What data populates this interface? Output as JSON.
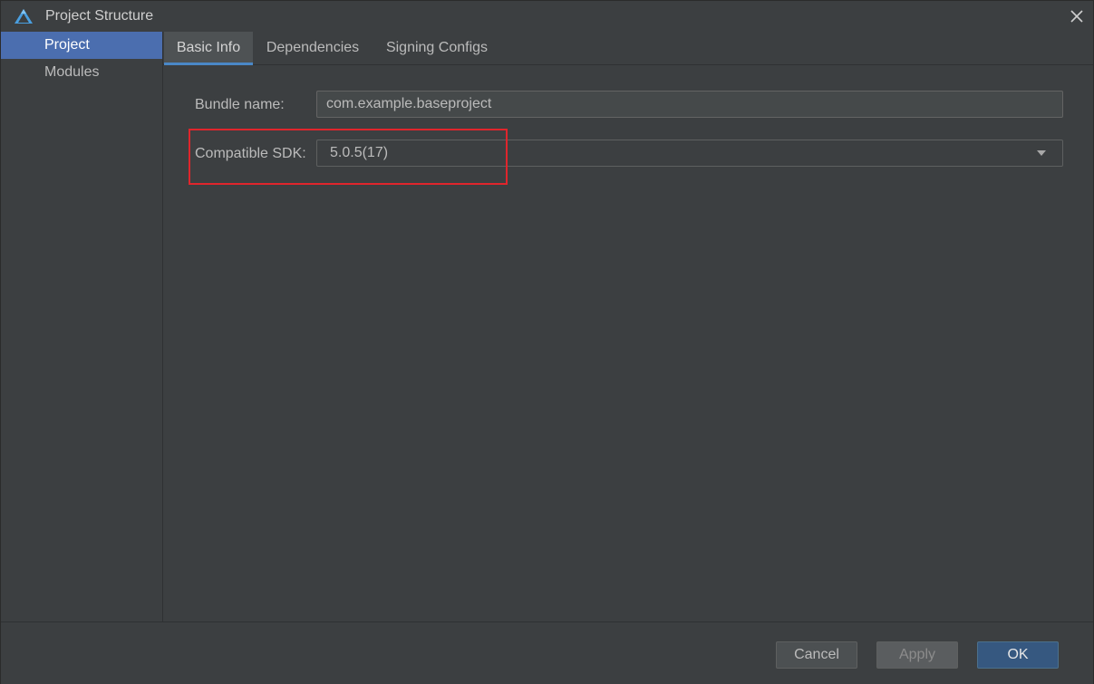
{
  "window": {
    "title": "Project Structure",
    "app_icon": "harmony-logo-icon",
    "close_icon": "close-icon"
  },
  "sidebar": {
    "items": [
      {
        "label": "Project",
        "selected": true
      },
      {
        "label": "Modules",
        "selected": false
      }
    ]
  },
  "tabs": [
    {
      "label": "Basic Info",
      "active": true
    },
    {
      "label": "Dependencies",
      "active": false
    },
    {
      "label": "Signing Configs",
      "active": false
    }
  ],
  "form": {
    "bundle_name": {
      "label": "Bundle name:",
      "value": "com.example.baseproject"
    },
    "compatible_sdk": {
      "label": "Compatible SDK:",
      "value": "5.0.5(17)",
      "dropdown_icon": "chevron-down-icon"
    }
  },
  "footer": {
    "cancel_label": "Cancel",
    "apply_label": "Apply",
    "ok_label": "OK"
  },
  "colors": {
    "background": "#3c3f41",
    "selection": "#4b6eaf",
    "tab_indicator": "#4a88c7",
    "highlight": "#e0252c",
    "ok_button": "#365880"
  }
}
